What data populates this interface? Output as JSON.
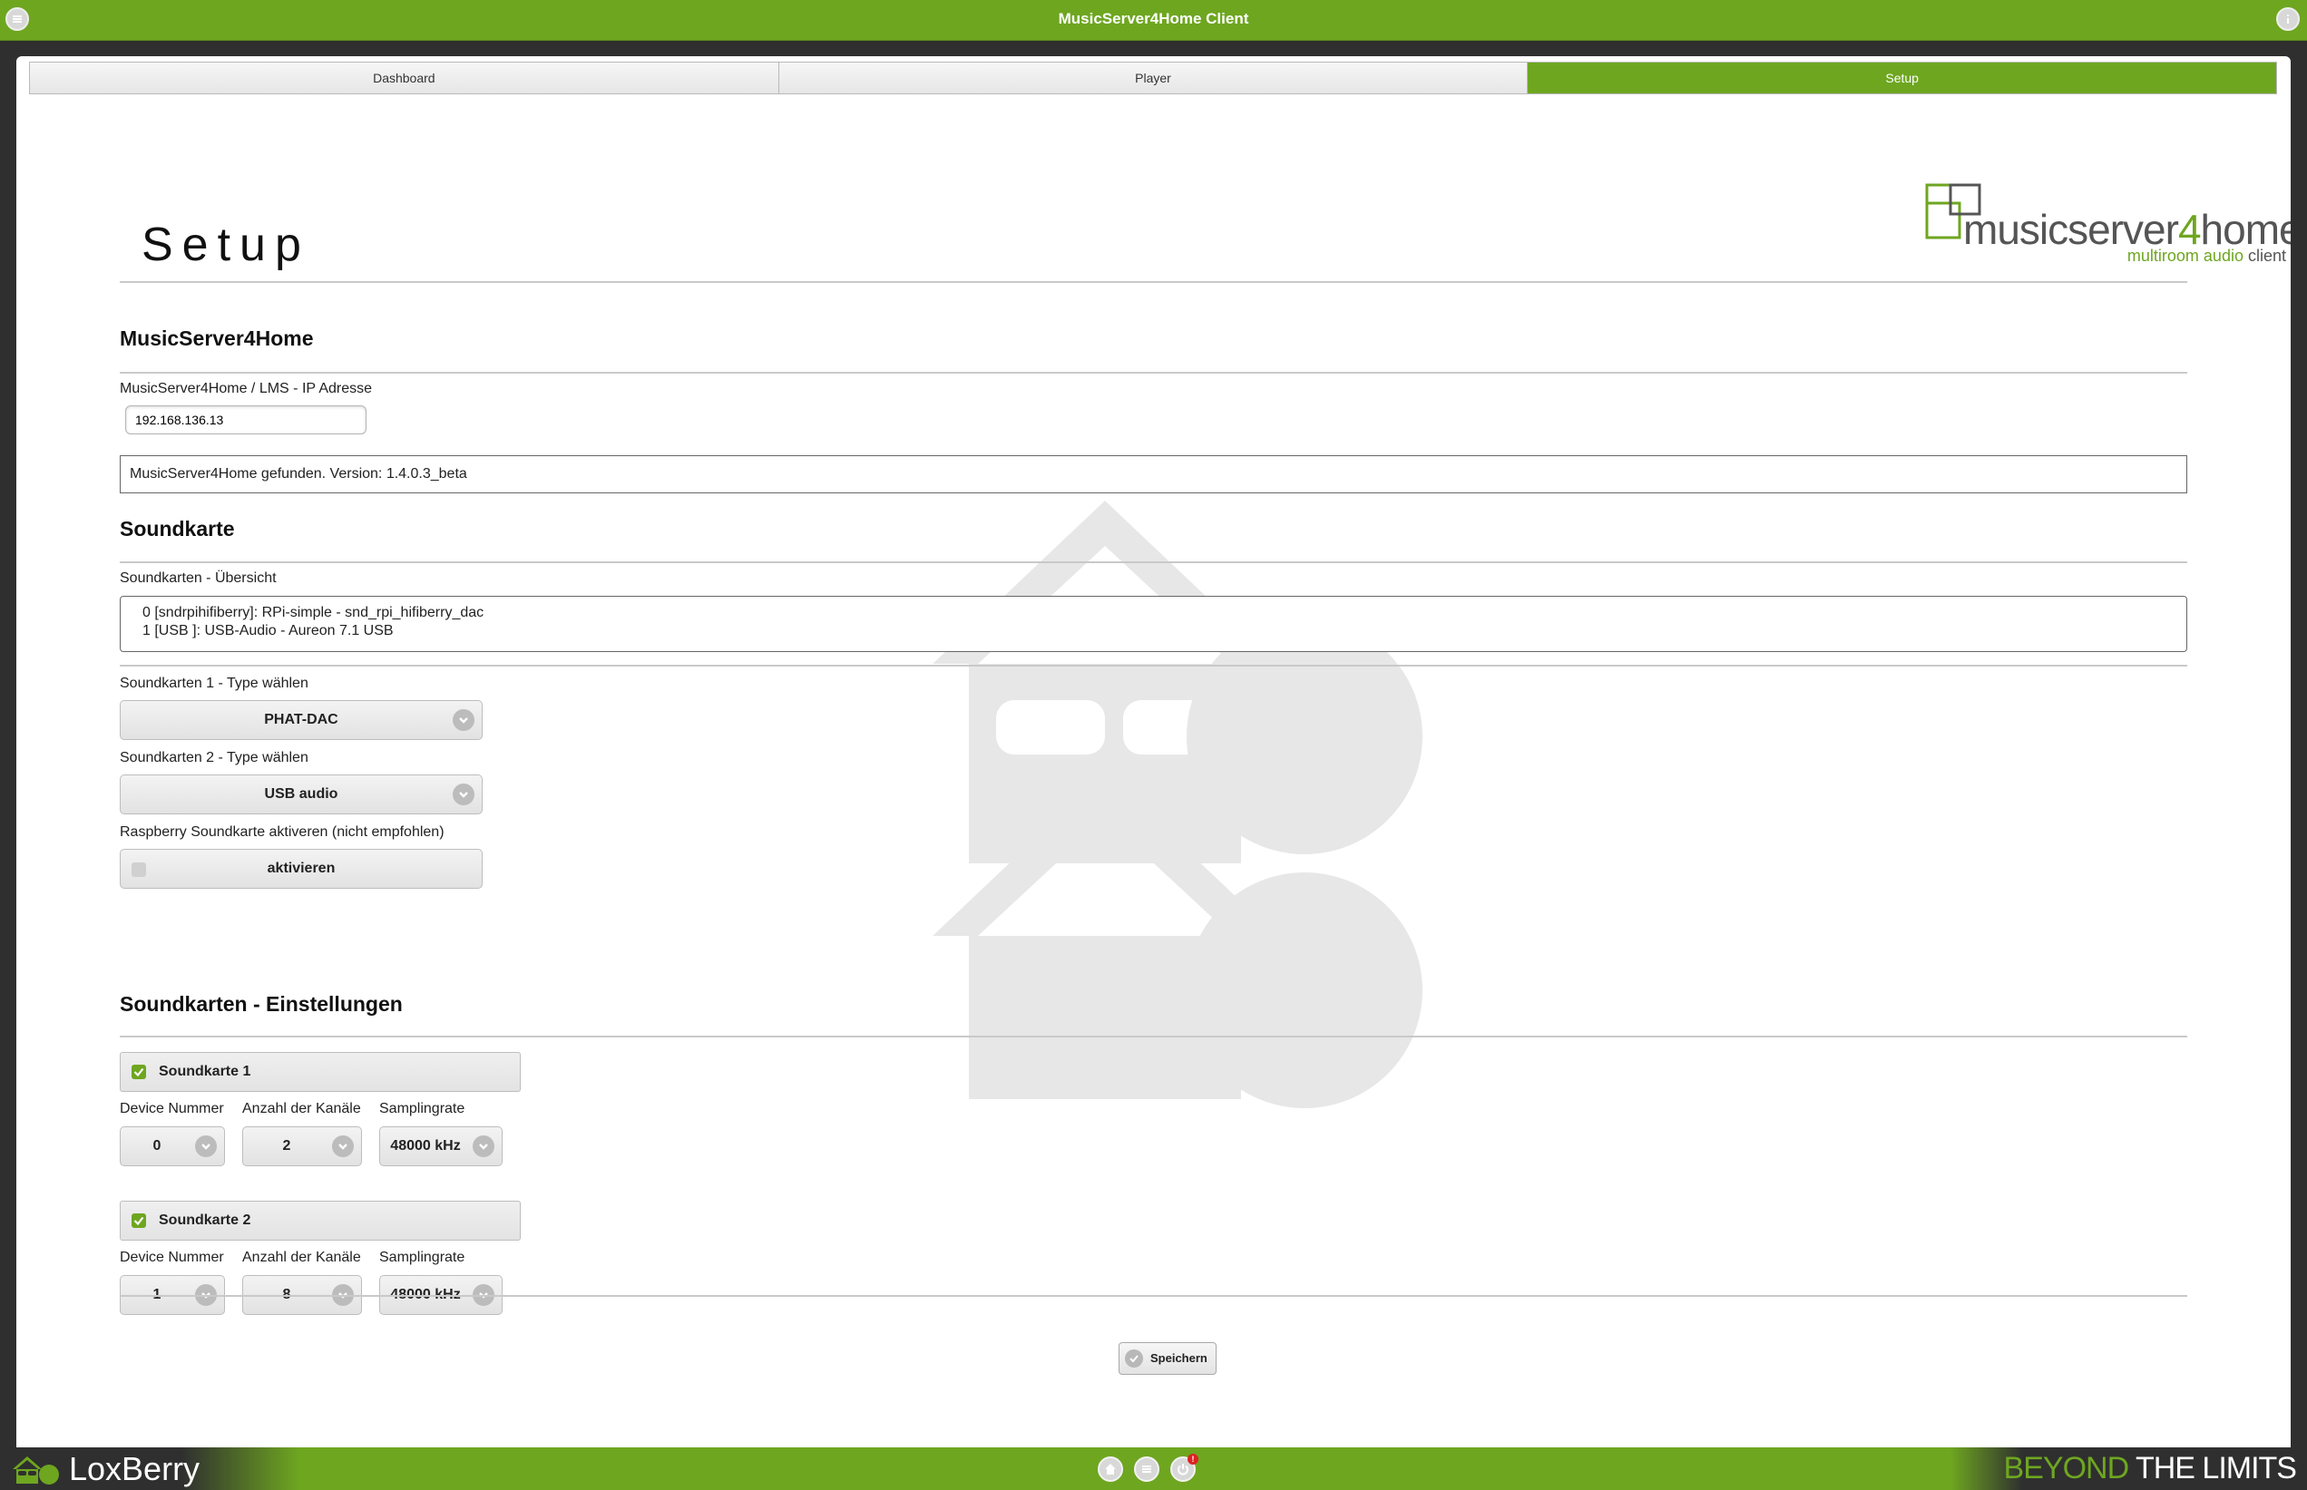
{
  "window": {
    "title": "MusicServer4Home Client"
  },
  "nav": {
    "tabs": [
      {
        "label": "Dashboard"
      },
      {
        "label": "Player"
      },
      {
        "label": "Setup",
        "active": true
      }
    ]
  },
  "logo": {
    "word_a": "musicserver",
    "word_b": "4",
    "word_c": "home",
    "sub_a": "multiroom audio ",
    "sub_b": "client"
  },
  "page": {
    "title": "Setup"
  },
  "ms4h": {
    "heading": "MusicServer4Home",
    "ip_label": "MusicServer4Home / LMS - IP Adresse",
    "ip_value": "192.168.136.13",
    "status": "MusicServer4Home gefunden. Version: 1.4.0.3_beta"
  },
  "soundcard": {
    "heading": "Soundkarte",
    "overview_label": "Soundkarten - Übersicht",
    "overview_lines": [
      "0 [sndrpihifiberry]: RPi-simple - snd_rpi_hifiberry_dac",
      "1 [USB ]: USB-Audio - Aureon 7.1 USB"
    ],
    "type1_label": "Soundkarten 1 - Type wählen",
    "type1_value": "PHAT-DAC",
    "type2_label": "Soundkarten 2 - Type wählen",
    "type2_value": "USB audio",
    "rpi_label": "Raspberry Soundkarte aktiveren (nicht empfohlen)",
    "rpi_button": "aktivieren",
    "rpi_checked": false
  },
  "settings": {
    "heading": "Soundkarten - Einstellungen",
    "cards": [
      {
        "title": "Soundkarte 1",
        "checked": true,
        "device_label": "Device Nummer",
        "device": "0",
        "channels_label": "Anzahl der Kanäle",
        "channels": "2",
        "rate_label": "Samplingrate",
        "rate": "48000 kHz"
      },
      {
        "title": "Soundkarte 2",
        "checked": true,
        "device_label": "Device Nummer",
        "device": "1",
        "channels_label": "Anzahl der Kanäle",
        "channels": "8",
        "rate_label": "Samplingrate",
        "rate": "48000 kHz"
      }
    ]
  },
  "actions": {
    "save_label": "Speichern"
  },
  "footer": {
    "brand": "LoxBerry",
    "slogan_a": "BEYOND",
    "slogan_b": " THE LIMITS",
    "notify_badge": "!"
  },
  "colors": {
    "accent": "#6ea620",
    "dark": "#2f2f2f"
  },
  "icons": [
    "menu-icon",
    "info-icon",
    "chevron-down-icon",
    "check-icon",
    "home-icon",
    "list-icon",
    "power-icon",
    "loxberry-logo-icon"
  ]
}
